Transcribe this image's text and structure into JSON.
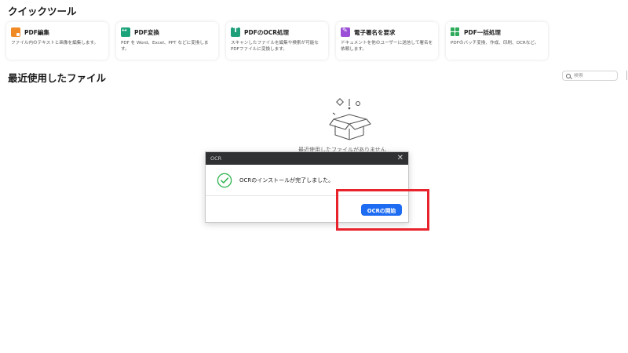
{
  "quick_tools": {
    "title": "クイックツール",
    "cards": [
      {
        "icon": "pdf-edit-icon",
        "name": "PDF編集",
        "description": "ファイル内のテキストと画像を編集します。"
      },
      {
        "icon": "pdf-convert-icon",
        "name": "PDF変換",
        "description": "PDF を Word、Excel、PPT などに変換します。"
      },
      {
        "icon": "pdf-ocr-icon",
        "name": "PDFのOCR処理",
        "description": "スキャンしたファイルを編集や検索が可能なPDFファイルに変換します。"
      },
      {
        "icon": "e-signature-icon",
        "name": "電子署名を要求",
        "description": "ドキュメントを他のユーザーに送信して署名を依頼します。"
      },
      {
        "icon": "pdf-batch-icon",
        "name": "PDF一括処理",
        "description": "PDFのバッチ変換、作成、印刷、OCRなど。"
      }
    ],
    "icon_colors": {
      "edit": "#f08a24",
      "convert": "#1aa37a",
      "ocr": "#1f9f7a",
      "sign": "#9b4fd6",
      "batch": "#2eaa5a"
    }
  },
  "recent_files": {
    "title": "最近使用したファイル",
    "search_placeholder": "検索",
    "empty_text": "最近使用したファイルがありません"
  },
  "dialog": {
    "title": "OCR",
    "message": "OCRのインストールが完了しました。",
    "primary_button": "OCRの開始",
    "accent_color": "#1e6cf2",
    "success_color": "#2db14c"
  },
  "highlight_color": "#e8232b"
}
